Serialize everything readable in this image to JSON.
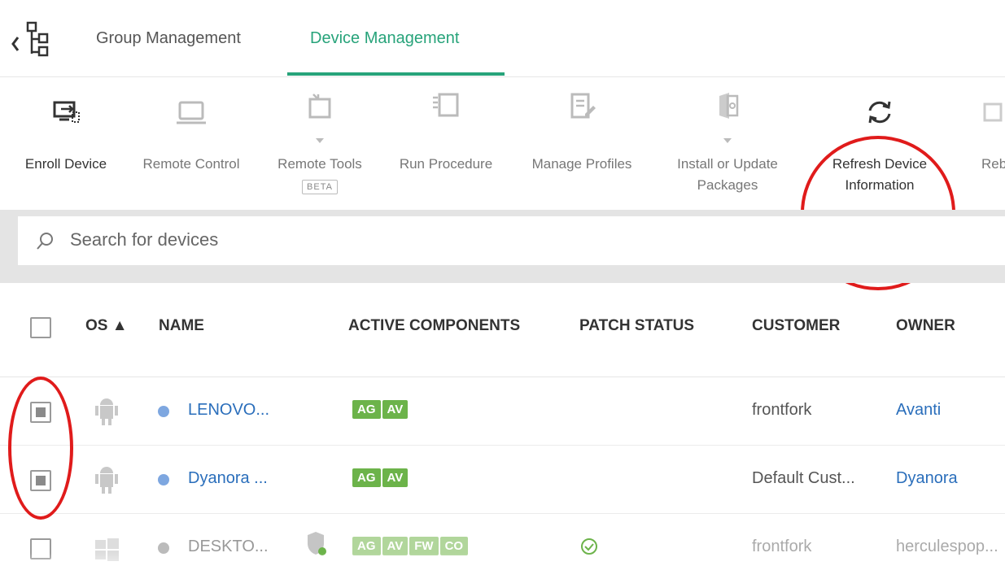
{
  "tabs": {
    "group": "Group Management",
    "device": "Device Management"
  },
  "toolbar": [
    {
      "label": "Enroll Device",
      "icon": "enroll-device-icon"
    },
    {
      "label": "Remote Control",
      "icon": "monitor-icon"
    },
    {
      "label": "Remote Tools",
      "icon": "remote-tools-icon",
      "badge": "BETA"
    },
    {
      "label": "Run Procedure",
      "icon": "run-procedure-icon"
    },
    {
      "label": "Manage Profiles",
      "icon": "manage-profiles-icon"
    },
    {
      "label": "Install or Update Packages",
      "icon": "package-icon"
    },
    {
      "label": "Refresh Device Information",
      "icon": "refresh-icon"
    },
    {
      "label": "Reb",
      "icon": "reboot-icon"
    }
  ],
  "search": {
    "placeholder": "Search for devices"
  },
  "table": {
    "headers": {
      "os": "OS ▲",
      "name": "NAME",
      "components": "ACTIVE COMPONENTS",
      "patch": "PATCH STATUS",
      "customer": "CUSTOMER",
      "owner": "OWNER"
    },
    "rows": [
      {
        "name": "LENOVO...",
        "components": [
          "AG",
          "AV"
        ],
        "customer": "frontfork",
        "owner": "Avanti",
        "checked": true
      },
      {
        "name": "Dyanora ...",
        "components": [
          "AG",
          "AV"
        ],
        "customer": "Default Cust...",
        "owner": "Dyanora",
        "checked": true
      },
      {
        "name": "DESKTO...",
        "components": [
          "AG",
          "AV",
          "FW",
          "CO"
        ],
        "customer": "frontfork",
        "owner": "herculespop...",
        "checked": false
      }
    ]
  },
  "colors": {
    "accent": "#27a37a",
    "highlight": "#e01b1b",
    "link": "#2a6ebb",
    "badge": "#6cb34a"
  }
}
